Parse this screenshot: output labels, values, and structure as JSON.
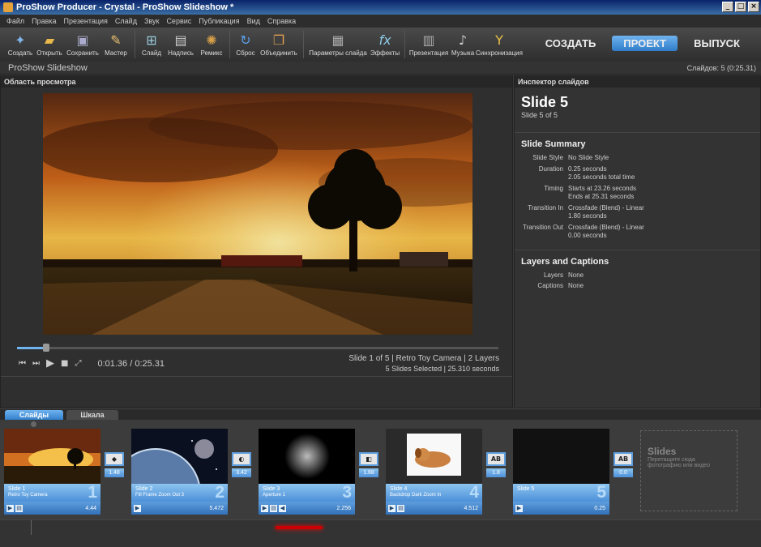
{
  "window": {
    "title": "ProShow Producer - Crystal - ProShow Slideshow *"
  },
  "menu": [
    "Файл",
    "Правка",
    "Презентация",
    "Слайд",
    "Звук",
    "Сервис",
    "Публикация",
    "Вид",
    "Справка"
  ],
  "toolbar": {
    "buttons": [
      {
        "label": "Создать",
        "icon": "new-show-icon"
      },
      {
        "label": "Открыть",
        "icon": "folder-open-icon"
      },
      {
        "label": "Сохранить",
        "icon": "save-icon"
      },
      {
        "label": "Мастер",
        "icon": "wizard-icon"
      },
      {
        "label": "Слайд",
        "icon": "add-slide-icon"
      },
      {
        "label": "Надпись",
        "icon": "caption-icon"
      },
      {
        "label": "Ремикс",
        "icon": "remix-icon"
      },
      {
        "label": "Сброс",
        "icon": "reset-icon"
      },
      {
        "label": "Объединить",
        "icon": "combine-icon"
      },
      {
        "label": "Параметры слайда",
        "icon": "slide-options-icon"
      },
      {
        "label": "Эффекты",
        "icon": "effects-icon"
      },
      {
        "label": "Презентация",
        "icon": "show-options-icon"
      },
      {
        "label": "Музыка",
        "icon": "music-icon"
      },
      {
        "label": "Синхронизация",
        "icon": "sync-icon"
      }
    ],
    "modes": {
      "create": "СОЗДАТЬ",
      "project": "ПРОЕКТ",
      "output": "ВЫПУСК"
    }
  },
  "show": {
    "title": "ProShow Slideshow",
    "slides_count": "Слайдов: 5 (0:25.31)"
  },
  "preview": {
    "header": "Область просмотра",
    "progress": 0.06,
    "time": "0:01.36 / 0:25.31",
    "info_line1": "Slide 1 of 5  |  Retro Toy Camera  |  2 Layers",
    "info_line2": "5 Slides Selected  |  25.310 seconds"
  },
  "inspector": {
    "header": "Инспектор слайдов",
    "title": "Slide 5",
    "subtitle": "Slide 5 of 5",
    "summary_heading": "Slide Summary",
    "style_label": "Slide Style",
    "style_value": "No Slide Style",
    "duration_label": "Duration",
    "duration_1": "0.25 seconds",
    "duration_2": "2.05 seconds total time",
    "timing_label": "Timing",
    "timing_1": "Starts at 23.26 seconds",
    "timing_2": "Ends at 25.31 seconds",
    "tin_label": "Transition In",
    "tin_1": "Crossfade (Blend) - Linear",
    "tin_2": "1.80 seconds",
    "tout_label": "Transition Out",
    "tout_1": "Crossfade (Blend) - Linear",
    "tout_2": "0.00 seconds",
    "layers_heading": "Layers and Captions",
    "layers_label": "Layers",
    "layers_value": "None",
    "captions_label": "Captions",
    "captions_value": "None"
  },
  "tabs": {
    "slides": "Слайды",
    "timeline": "Шкала"
  },
  "slides": [
    {
      "name": "Slide 1",
      "effect": "Retro Toy Camera",
      "num": "1",
      "duration": "4.44"
    },
    {
      "name": "Slide 2",
      "effect": "Fill Frame Zoom Out 3",
      "num": "2",
      "duration": "5.472"
    },
    {
      "name": "Slide 3",
      "effect": "Aperture 1",
      "num": "3",
      "duration": "2.256"
    },
    {
      "name": "Slide 4",
      "effect": "Backdrop Dark Zoom In",
      "num": "4",
      "duration": "4.512"
    },
    {
      "name": "Slide 5",
      "effect": "",
      "num": "5",
      "duration": "0.25"
    }
  ],
  "transitions": [
    {
      "symbol": "◆",
      "value": "1.48"
    },
    {
      "symbol": "◐",
      "value": "3.42"
    },
    {
      "symbol": "◧",
      "value": "1.68"
    },
    {
      "symbol": "AB",
      "value": "1.8"
    },
    {
      "symbol": "AB",
      "value": "0.0"
    }
  ],
  "empty_slot": {
    "title": "Slides",
    "hint": "Перетащите сюда фотографию или видео"
  },
  "colors": {
    "accent": "#4d90d8",
    "accent_light": "#8cc4f0",
    "background": "#3a3a3a"
  }
}
